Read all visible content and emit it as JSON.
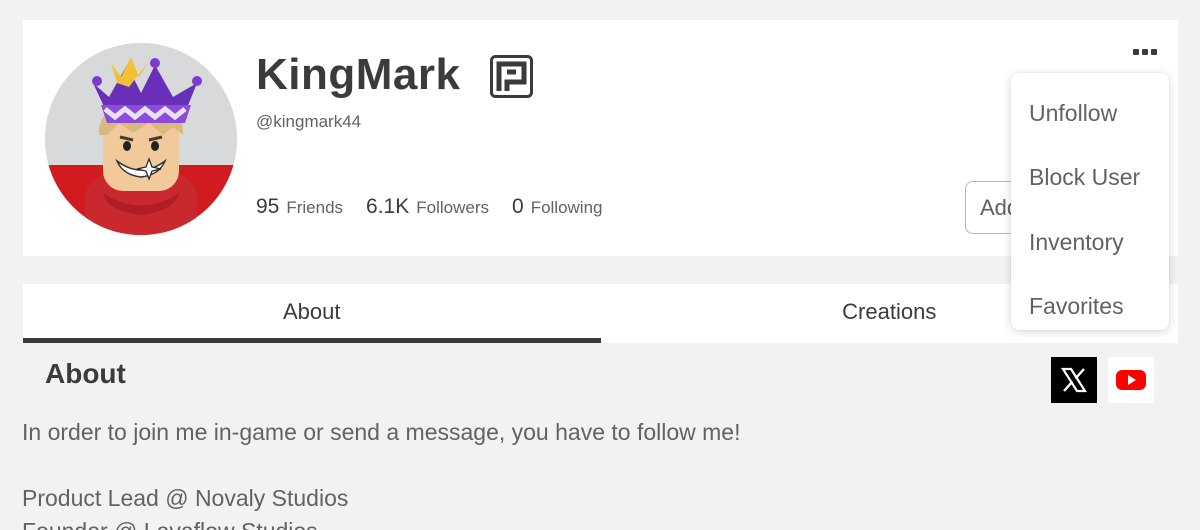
{
  "profile": {
    "display_name": "KingMark",
    "username": "@kingmark44",
    "badge_icon": "verified-badge-icon",
    "stats": [
      {
        "value": "95",
        "label": "Friends"
      },
      {
        "value": "6.1K",
        "label": "Followers"
      },
      {
        "value": "0",
        "label": "Following"
      }
    ],
    "add_button_label": "Add Friend",
    "more_icon": "more-options-icon"
  },
  "tabs": [
    {
      "label": "About",
      "active": true
    },
    {
      "label": "Creations",
      "active": false
    }
  ],
  "about": {
    "heading": "About",
    "text": "In order to join me in-game or send a message, you have to follow me!\n\nProduct Lead @ Novaly Studios\nFounder @ Lavaflow Studios",
    "social_links": [
      {
        "icon": "x-twitter-icon",
        "color": "#000000"
      },
      {
        "icon": "youtube-icon",
        "color": "#ff0000"
      }
    ]
  },
  "dropdown_menu": {
    "items": [
      "Unfollow",
      "Block User",
      "Inventory",
      "Favorites"
    ]
  }
}
